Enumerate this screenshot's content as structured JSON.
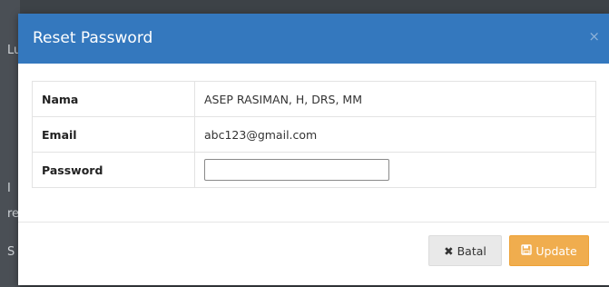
{
  "backdrop": {
    "glyphs": [
      "Lu",
      "I",
      "re",
      "S"
    ]
  },
  "modal": {
    "title": "Reset Password",
    "close_symbol": "×",
    "rows": [
      {
        "label": "Nama",
        "value": "ASEP RASIMAN, H, DRS, MM"
      },
      {
        "label": "Email",
        "value": "abc123@gmail.com"
      },
      {
        "label": "Password",
        "value": ""
      }
    ],
    "buttons": {
      "cancel_label": "Batal",
      "cancel_icon": "close-icon",
      "update_label": "Update",
      "update_icon": "save-icon"
    }
  },
  "colors": {
    "header": "#3478be",
    "update_button": "#f0ad4e",
    "cancel_button": "#e9e9e9"
  }
}
